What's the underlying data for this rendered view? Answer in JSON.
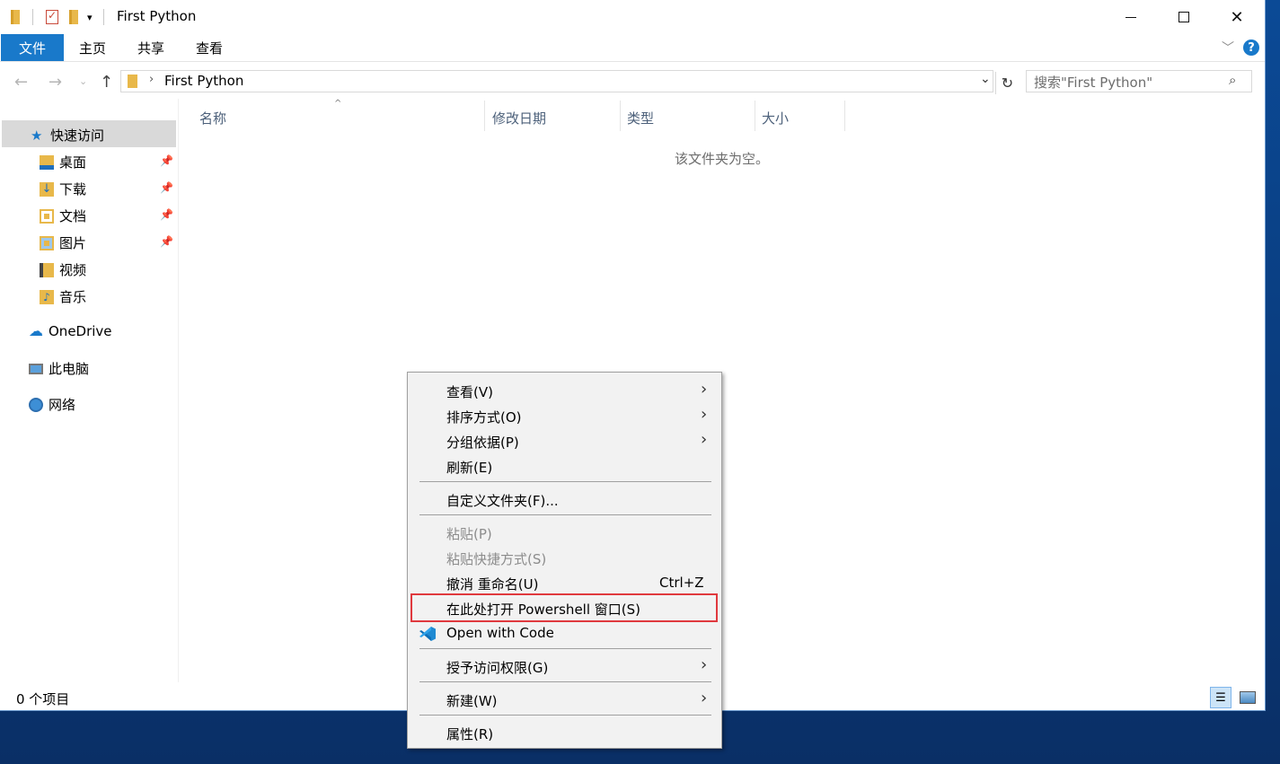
{
  "window": {
    "title": "First Python"
  },
  "ribbon": {
    "tabs": [
      "文件",
      "主页",
      "共享",
      "查看"
    ],
    "help": "?"
  },
  "address": {
    "path": "First Python",
    "search_placeholder": "搜索\"First Python\""
  },
  "nav": {
    "quick_access": "快速访问",
    "items": [
      {
        "label": "桌面",
        "pinned": true
      },
      {
        "label": "下载",
        "pinned": true
      },
      {
        "label": "文档",
        "pinned": true
      },
      {
        "label": "图片",
        "pinned": true
      },
      {
        "label": "视频",
        "pinned": false
      },
      {
        "label": "音乐",
        "pinned": false
      }
    ],
    "onedrive": "OneDrive",
    "this_pc": "此电脑",
    "network": "网络"
  },
  "columns": [
    "名称",
    "修改日期",
    "类型",
    "大小"
  ],
  "empty_message": "该文件夹为空。",
  "status": "0 个项目",
  "context_menu": {
    "items": [
      {
        "label": "查看(V)",
        "submenu": true,
        "disabled": false
      },
      {
        "label": "排序方式(O)",
        "submenu": true,
        "disabled": false
      },
      {
        "label": "分组依据(P)",
        "submenu": true,
        "disabled": false
      },
      {
        "label": "刷新(E)",
        "submenu": false,
        "disabled": false
      },
      {
        "label": "自定义文件夹(F)...",
        "submenu": false,
        "disabled": false
      },
      {
        "label": "粘贴(P)",
        "submenu": false,
        "disabled": true
      },
      {
        "label": "粘贴快捷方式(S)",
        "submenu": false,
        "disabled": true
      },
      {
        "label": "撤消 重命名(U)",
        "shortcut": "Ctrl+Z",
        "submenu": false,
        "disabled": false
      },
      {
        "label": "在此处打开 Powershell 窗口(S)",
        "submenu": false,
        "disabled": false,
        "highlighted": true
      },
      {
        "label": "Open with Code",
        "submenu": false,
        "disabled": false,
        "icon": "vscode-icon"
      },
      {
        "label": "授予访问权限(G)",
        "submenu": true,
        "disabled": false
      },
      {
        "label": "新建(W)",
        "submenu": true,
        "disabled": false
      },
      {
        "label": "属性(R)",
        "submenu": false,
        "disabled": false
      }
    ]
  },
  "colors": {
    "accent": "#1979ca",
    "highlight_border": "#e0393e",
    "selection": "#d9d9d9"
  }
}
